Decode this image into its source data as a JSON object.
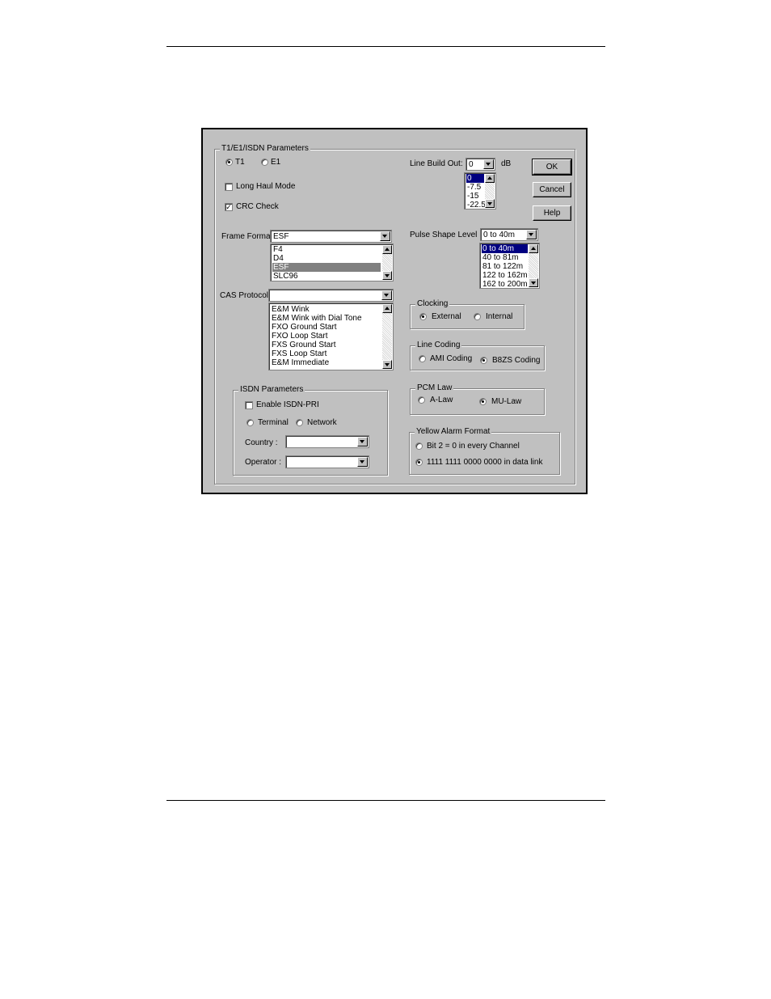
{
  "dialog": {
    "main_group_title": "T1/E1/ISDN Parameters",
    "type_radios": [
      {
        "label": "T1",
        "selected": true
      },
      {
        "label": "E1",
        "selected": false
      }
    ],
    "long_haul": {
      "label": "Long Haul Mode",
      "checked": false
    },
    "crc_check": {
      "label": "CRC Check",
      "checked": true
    },
    "line_build_out": {
      "label": "Line Build Out:",
      "value": "0",
      "unit": "dB",
      "options": [
        "0",
        "-7.5",
        "-15",
        "-22.5"
      ]
    },
    "buttons": {
      "ok": "OK",
      "cancel": "Cancel",
      "help": "Help"
    },
    "frame_format": {
      "label": "Frame Format:",
      "value": "ESF",
      "options": [
        "F4",
        "D4",
        "ESF",
        "SLC96"
      ]
    },
    "pulse_shape": {
      "label": "Pulse Shape Level",
      "value": "0 to 40m",
      "options": [
        "0 to 40m",
        "40 to 81m",
        "81 to 122m",
        "122 to 162m",
        "162 to 200m"
      ]
    },
    "cas_protocol": {
      "label": "CAS Protocol:",
      "value": "",
      "options": [
        "E&M Wink",
        "E&M Wink with Dial Tone",
        "FXO Ground Start",
        "FXO Loop Start",
        "FXS Ground Start",
        "FXS Loop Start",
        "E&M Immediate"
      ]
    },
    "clocking": {
      "title": "Clocking",
      "options": [
        {
          "label": "External",
          "selected": true
        },
        {
          "label": "Internal",
          "selected": false
        }
      ]
    },
    "line_coding": {
      "title": "Line Coding",
      "options": [
        {
          "label": "AMI Coding",
          "selected": false
        },
        {
          "label": "B8ZS Coding",
          "selected": true
        }
      ]
    },
    "pcm_law": {
      "title": "PCM Law",
      "options": [
        {
          "label": "A-Law",
          "selected": false
        },
        {
          "label": "MU-Law",
          "selected": true
        }
      ]
    },
    "isdn": {
      "title": "ISDN Parameters",
      "enable": {
        "label": "Enable ISDN-PRI",
        "checked": false
      },
      "role_radios": [
        {
          "label": "Terminal",
          "selected": false
        },
        {
          "label": "Network",
          "selected": false
        }
      ],
      "country": {
        "label": "Country :",
        "value": ""
      },
      "operator": {
        "label": "Operator :",
        "value": ""
      }
    },
    "yellow_alarm": {
      "title": "Yellow Alarm Format",
      "options": [
        {
          "label": "Bit 2 = 0 in every Channel",
          "selected": false
        },
        {
          "label": "1111 1111 0000 0000 in data link",
          "selected": true
        }
      ]
    }
  }
}
